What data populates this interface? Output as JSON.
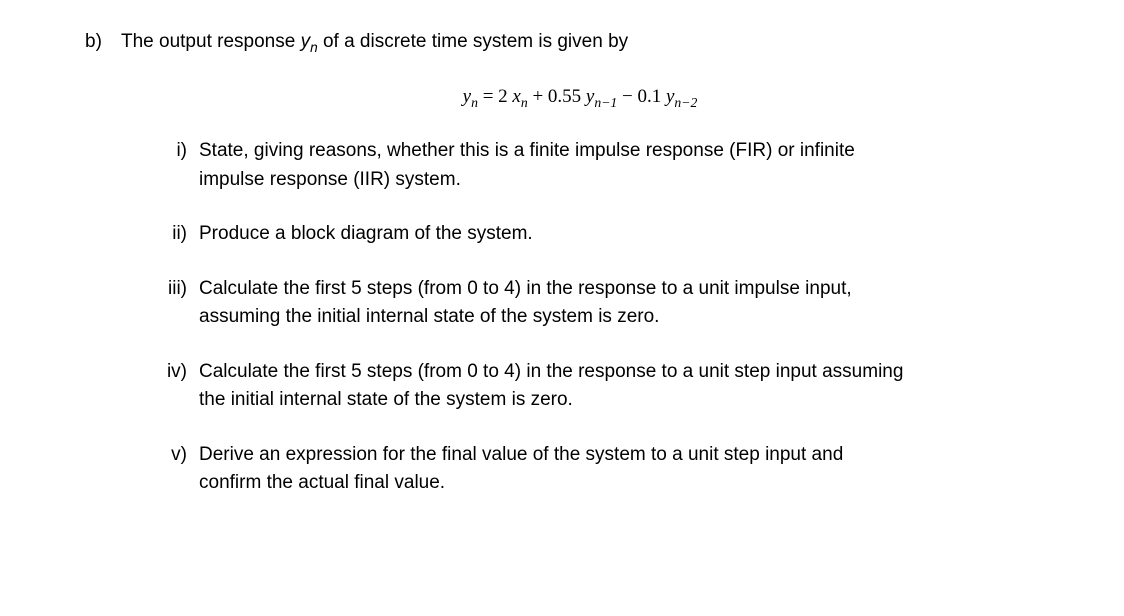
{
  "question": {
    "label": "b)",
    "intro_part1": "The output response ",
    "intro_var": "y",
    "intro_sub": "n",
    "intro_part2": " of a discrete time system is given by",
    "equation": {
      "lhs_var": "y",
      "lhs_sub": "n",
      "eq": " = ",
      "t1_coef": "2 ",
      "t1_var": "x",
      "t1_sub": "n",
      "t2_op": " + ",
      "t2_coef": "0.55 ",
      "t2_var": "y",
      "t2_sub": "n−1",
      "t3_op": " − ",
      "t3_coef": "0.1 ",
      "t3_var": "y",
      "t3_sub": "n−2"
    },
    "subs": [
      {
        "label": "i)",
        "text": "State, giving reasons, whether this is a finite impulse response (FIR) or infinite impulse response (IIR) system."
      },
      {
        "label": "ii)",
        "text": "Produce a block diagram of the system."
      },
      {
        "label": "iii)",
        "text": "Calculate the first 5 steps (from 0 to 4) in the response to a unit impulse input, assuming the initial internal state of the system is zero."
      },
      {
        "label": "iv)",
        "text": "Calculate the first 5 steps (from 0 to 4) in the response to a unit step input assuming the initial internal state of the system is zero."
      },
      {
        "label": "v)",
        "text": "Derive an expression for the final value of the system to a unit step input and confirm the actual final value."
      }
    ]
  }
}
